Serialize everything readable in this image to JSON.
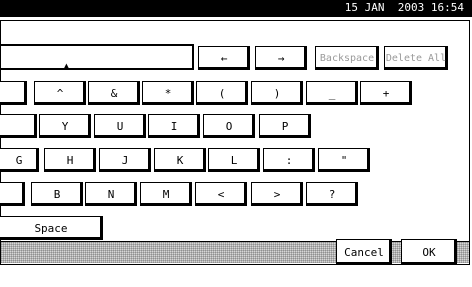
{
  "header": {
    "datetime": "15 JAN  2003 16:54"
  },
  "input": {
    "cursor": "▲"
  },
  "nav": {
    "left_arrow": "←",
    "right_arrow": "→"
  },
  "edit": {
    "backspace": "Backspace",
    "delete_all": "Delete All"
  },
  "rows": {
    "symbols": [
      "^",
      "&",
      "*",
      "(",
      ")",
      "_",
      "+"
    ],
    "top": [
      "Y",
      "U",
      "I",
      "O",
      "P"
    ],
    "mid": [
      "G",
      "H",
      "J",
      "K",
      "L",
      ":",
      "\""
    ],
    "bot": [
      "B",
      "N",
      "M",
      "<",
      ">",
      "?"
    ]
  },
  "space_label": "Space",
  "actions": {
    "cancel": "Cancel",
    "ok": "OK"
  }
}
